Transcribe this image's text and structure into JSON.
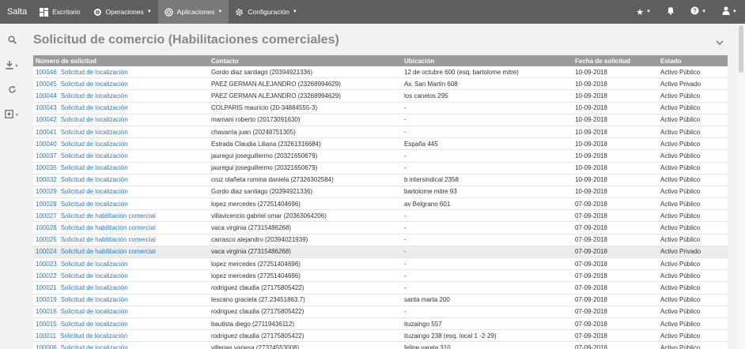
{
  "navbar": {
    "brand": "Salta",
    "items": [
      {
        "label": "Escritorio",
        "icon": "dashboard-icon",
        "caret": false
      },
      {
        "label": "Operaciones",
        "icon": "gear-icon",
        "caret": true
      },
      {
        "label": "Aplicaciones",
        "icon": "apps-icon",
        "caret": true,
        "active": true
      },
      {
        "label": "Configuración",
        "icon": "settings-icon",
        "caret": true
      }
    ],
    "right": [
      "star-icon",
      "bell-icon",
      "help-icon",
      "user-icon"
    ]
  },
  "rail": [
    "search-icon",
    "download-icon",
    "refresh-icon",
    "export-icon"
  ],
  "page": {
    "title": "Solicitud de comercio (Habilitaciones comerciales)"
  },
  "table": {
    "headers": [
      "Número de solicitud",
      "Contacto",
      "Ubicación",
      "Fecha de solicitud",
      "Estado"
    ],
    "rows": [
      {
        "num": "100046",
        "tipo": "Solicitud de localización",
        "contacto": "Gordo diaz santiago (20394921336)",
        "ubicacion": "12 de octubre 600 (esq. bartolome mitre)",
        "fecha": "10-09-2018",
        "estado": "Activo Público"
      },
      {
        "num": "100045",
        "tipo": "Solicitud de localización",
        "contacto": "PAEZ GERMAN ALEJANDRO (23268994629)",
        "ubicacion": "Av. San Martín 608",
        "fecha": "10-09-2018",
        "estado": "Activo Privado"
      },
      {
        "num": "100044",
        "tipo": "Solicitud de localización",
        "contacto": "PAEZ GERMAN ALEJANDRO (23268994629)",
        "ubicacion": "los canelos 295",
        "fecha": "10-09-2018",
        "estado": "Activo Público"
      },
      {
        "num": "100043",
        "tipo": "Solicitud de localización",
        "contacto": "COLPARIS mauricio (20-34884555-3)",
        "ubicacion": "-",
        "fecha": "10-09-2018",
        "estado": "Activo Público"
      },
      {
        "num": "100042",
        "tipo": "Solicitud de localización",
        "contacto": "mamani roberto (20173091630)",
        "ubicacion": "-",
        "fecha": "10-09-2018",
        "estado": "Activo Público"
      },
      {
        "num": "100041",
        "tipo": "Solicitud de localización",
        "contacto": "chavarria juan (20248751305)",
        "ubicacion": "-",
        "fecha": "10-09-2018",
        "estado": "Activo Público"
      },
      {
        "num": "100040",
        "tipo": "Solicitud de localización",
        "contacto": "Estrada Claudia Liliana (23261316684)",
        "ubicacion": "España 445",
        "fecha": "10-09-2018",
        "estado": "Activo Público"
      },
      {
        "num": "100037",
        "tipo": "Solicitud de localización",
        "contacto": "jauregui joseguillermo (20321650679)",
        "ubicacion": "-",
        "fecha": "10-09-2018",
        "estado": "Activo Público"
      },
      {
        "num": "100035",
        "tipo": "Solicitud de localización",
        "contacto": "jauregui joseguillermo (20321650679)",
        "ubicacion": "-",
        "fecha": "10-09-2018",
        "estado": "Activo Público"
      },
      {
        "num": "100032",
        "tipo": "Solicitud de localización",
        "contacto": "cruz olañeta romina daniela (27326302584)",
        "ubicacion": "b intersindical 2358",
        "fecha": "10-09-2018",
        "estado": "Activo Público"
      },
      {
        "num": "100029",
        "tipo": "Solicitud de localización",
        "contacto": "Gordo diaz santiago (20394921336)",
        "ubicacion": "bartolome mitre 93",
        "fecha": "10-09-2018",
        "estado": "Activo Público"
      },
      {
        "num": "100028",
        "tipo": "Solicitud de localización",
        "contacto": "lopez mercedes (27251404696)",
        "ubicacion": "av Belgrano 601",
        "fecha": "07-09-2018",
        "estado": "Activo Público"
      },
      {
        "num": "100027",
        "tipo": "Solicitud de habilitación comercial",
        "contacto": "villavicencio gabriel omar (20363064206)",
        "ubicacion": "-",
        "fecha": "07-09-2018",
        "estado": "Activo Público"
      },
      {
        "num": "100026",
        "tipo": "Solicitud de habilitación comercial",
        "contacto": "vaca virginia (27315486268)",
        "ubicacion": "-",
        "fecha": "07-09-2018",
        "estado": "Activo Público"
      },
      {
        "num": "100025",
        "tipo": "Solicitud de habilitación comercial",
        "contacto": "carrasco alejandro (20394021939)",
        "ubicacion": "-",
        "fecha": "07-09-2018",
        "estado": "Activo Público"
      },
      {
        "num": "100024",
        "tipo": "Solicitud de habilitación comercial",
        "contacto": "vaca virginia (27315486268)",
        "ubicacion": "-",
        "fecha": "07-09-2018",
        "estado": "Activo Privado",
        "highlight": true
      },
      {
        "num": "100023",
        "tipo": "Solicitud de localización",
        "contacto": "lopez mercedes (27251404696)",
        "ubicacion": "-",
        "fecha": "07-09-2018",
        "estado": "Activo Público"
      },
      {
        "num": "100022",
        "tipo": "Solicitud de localización",
        "contacto": "lopez mercedes (27251404696)",
        "ubicacion": "-",
        "fecha": "07-09-2018",
        "estado": "Activo Público"
      },
      {
        "num": "100021",
        "tipo": "Solicitud de localización",
        "contacto": "rodriguez claudia (27175805422)",
        "ubicacion": "-",
        "fecha": "07-09-2018",
        "estado": "Activo Público"
      },
      {
        "num": "100019",
        "tipo": "Solicitud de localización",
        "contacto": "lescano graciela (27.23451863.7)",
        "ubicacion": "santa marta 200",
        "fecha": "07-09-2018",
        "estado": "Activo Público"
      },
      {
        "num": "100016",
        "tipo": "Solicitud de localización",
        "contacto": "rodriguez claudia (27175805422)",
        "ubicacion": "-",
        "fecha": "07-09-2018",
        "estado": "Activo Público"
      },
      {
        "num": "100015",
        "tipo": "Solicitud de localización",
        "contacto": "bautista diego (27119436112)",
        "ubicacion": "ituzaingo 557",
        "fecha": "07-09-2018",
        "estado": "Activo Público"
      },
      {
        "num": "100011",
        "tipo": "Solicitud de localización",
        "contacto": "rodriguez claudia (27175805422)",
        "ubicacion": "ituzaingo 238 (esq. local 1 -2-29)",
        "fecha": "07-09-2018",
        "estado": "Activo Público"
      },
      {
        "num": "100006",
        "tipo": "Solicitud de localización",
        "contacto": "villegas vanesa (27324553008)",
        "ubicacion": "felipe varela 310",
        "fecha": "07-09-2018",
        "estado": "Activo Público"
      }
    ]
  }
}
